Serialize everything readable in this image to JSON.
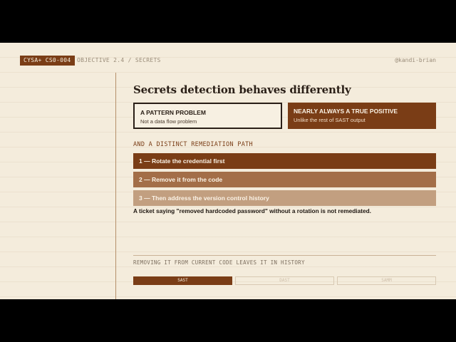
{
  "header": {
    "badge": "CYSA+ CS0-004",
    "objective": "OBJECTIVE 2.4 / SECRETS",
    "handle": "@kandi-brian"
  },
  "slide": {
    "title": "Secrets detection behaves differently",
    "cards": [
      {
        "heading": "A PATTERN PROBLEM",
        "sub": "Not a data flow problem"
      },
      {
        "heading": "NEARLY ALWAYS A TRUE POSITIVE",
        "sub": "Unlike the rest of SAST output"
      }
    ],
    "subheading": "AND A DISTINCT REMEDIATION PATH",
    "steps": [
      "1 — Rotate the credential first",
      "2 — Remove it from the code",
      "3 — Then address the version control history"
    ],
    "note": "A ticket saying \"removed hardcoded password\" without a rotation is not remediated.",
    "footer_caption": "REMOVING IT FROM CURRENT CODE LEAVES IT IN HISTORY",
    "tabs": [
      {
        "label": "SAST",
        "active": true
      },
      {
        "label": "DAST",
        "active": false
      },
      {
        "label": "SAMM",
        "active": false
      }
    ]
  },
  "colors": {
    "accent": "#7a3d16",
    "step2": "#a36e48",
    "step3": "#c29f80",
    "background": "#f4ecdc"
  }
}
